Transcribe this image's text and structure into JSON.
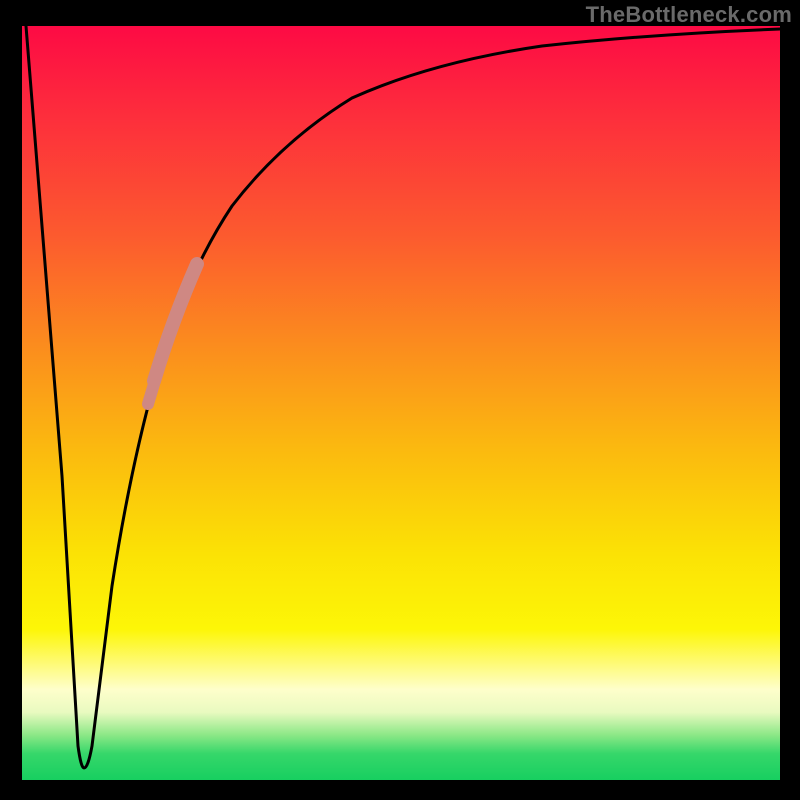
{
  "watermark": "TheBottleneck.com",
  "chart_data": {
    "type": "line",
    "title": "",
    "xlabel": "",
    "ylabel": "",
    "xlim": [
      0,
      100
    ],
    "ylim": [
      0,
      100
    ],
    "series": [
      {
        "name": "bottleneck-curve",
        "x": [
          0,
          3,
          6,
          7,
          8,
          10,
          12,
          15,
          18,
          22,
          26,
          30,
          35,
          40,
          50,
          60,
          70,
          80,
          90,
          100
        ],
        "y": [
          100,
          60,
          10,
          3,
          5,
          20,
          35,
          50,
          60,
          68,
          74,
          79,
          84,
          87,
          91,
          93.5,
          95,
          96,
          96.8,
          97.2
        ]
      }
    ],
    "annotations": [
      {
        "name": "highlight-segment",
        "x_range": [
          15,
          22
        ],
        "y_range": [
          50,
          68
        ],
        "color": "#cf8883"
      }
    ],
    "gradient_stops": [
      {
        "pos": 0.0,
        "color": "#fd0a44"
      },
      {
        "pos": 0.28,
        "color": "#fc5b2e"
      },
      {
        "pos": 0.56,
        "color": "#fbb90f"
      },
      {
        "pos": 0.8,
        "color": "#fdf607"
      },
      {
        "pos": 0.91,
        "color": "#e9fac0"
      },
      {
        "pos": 0.96,
        "color": "#36d76a"
      },
      {
        "pos": 1.0,
        "color": "#17cf60"
      }
    ]
  }
}
